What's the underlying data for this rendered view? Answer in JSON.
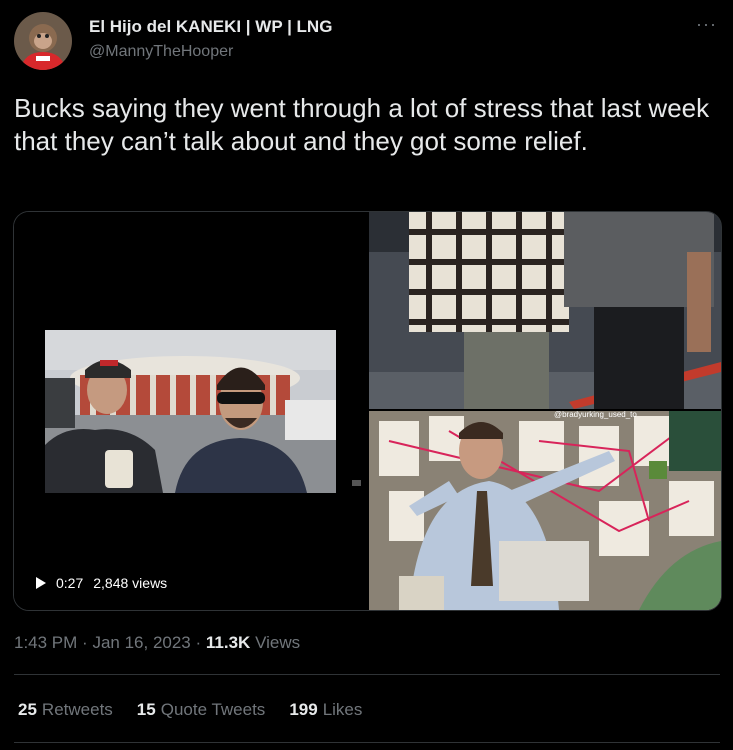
{
  "author": {
    "display_name": "El Hijo del KANEKI | WP | LNG",
    "handle": "@MannyTheHooper"
  },
  "menu": {
    "more_label": "···"
  },
  "tweet": {
    "text": "Bucks saying they went through a lot of stress that last week that they can’t talk about and they got some relief."
  },
  "video": {
    "duration": "0:27",
    "views": "2,848 views"
  },
  "images": {
    "bottom_watermark": "@bradyurking_used_to"
  },
  "meta": {
    "time": "1:43 PM",
    "separator": "·",
    "date": "Jan 16, 2023",
    "view_count": "11.3K",
    "views_label": "Views"
  },
  "stats": {
    "retweets_count": "25",
    "retweets_label": "Retweets",
    "quotes_count": "15",
    "quotes_label": "Quote Tweets",
    "likes_count": "199",
    "likes_label": "Likes"
  },
  "colors": {
    "background": "#000000",
    "text_primary": "#e7e9ea",
    "text_secondary": "#71767b",
    "border": "#2f3336"
  }
}
